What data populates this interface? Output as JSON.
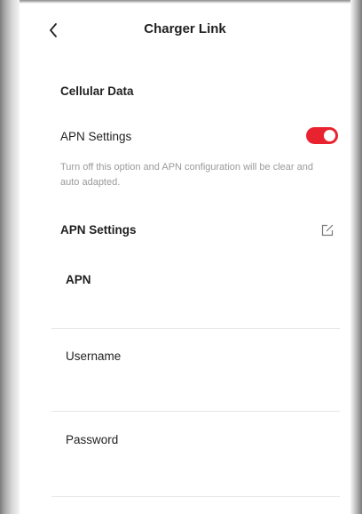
{
  "header": {
    "title": "Charger Link"
  },
  "cellular": {
    "section_title": "Cellular Data",
    "apn_toggle_label": "APN Settings",
    "apn_toggle_on": true,
    "hint": "Turn off this option and APN configuration will be clear and auto adapted."
  },
  "apn_settings": {
    "title": "APN Settings",
    "fields": {
      "apn": {
        "label": "APN",
        "value": ""
      },
      "username": {
        "label": "Username",
        "value": ""
      },
      "password": {
        "label": "Password",
        "value": ""
      }
    }
  },
  "colors": {
    "accent": "#e8232f",
    "text": "#1f1f1f",
    "hint": "#9a9a9a",
    "divider": "#e6e6e6"
  },
  "icons": {
    "back": "chevron-left-icon",
    "edit": "edit-icon"
  }
}
